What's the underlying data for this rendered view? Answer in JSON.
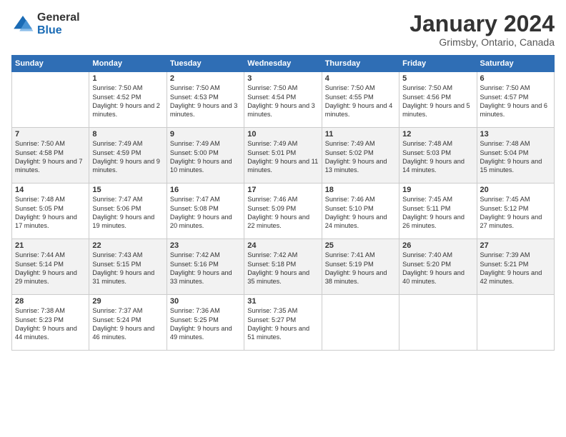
{
  "logo": {
    "general": "General",
    "blue": "Blue"
  },
  "title": "January 2024",
  "location": "Grimsby, Ontario, Canada",
  "weekdays": [
    "Sunday",
    "Monday",
    "Tuesday",
    "Wednesday",
    "Thursday",
    "Friday",
    "Saturday"
  ],
  "weeks": [
    [
      {
        "day": "",
        "sunrise": "",
        "sunset": "",
        "daylight": ""
      },
      {
        "day": "1",
        "sunrise": "Sunrise: 7:50 AM",
        "sunset": "Sunset: 4:52 PM",
        "daylight": "Daylight: 9 hours and 2 minutes."
      },
      {
        "day": "2",
        "sunrise": "Sunrise: 7:50 AM",
        "sunset": "Sunset: 4:53 PM",
        "daylight": "Daylight: 9 hours and 3 minutes."
      },
      {
        "day": "3",
        "sunrise": "Sunrise: 7:50 AM",
        "sunset": "Sunset: 4:54 PM",
        "daylight": "Daylight: 9 hours and 3 minutes."
      },
      {
        "day": "4",
        "sunrise": "Sunrise: 7:50 AM",
        "sunset": "Sunset: 4:55 PM",
        "daylight": "Daylight: 9 hours and 4 minutes."
      },
      {
        "day": "5",
        "sunrise": "Sunrise: 7:50 AM",
        "sunset": "Sunset: 4:56 PM",
        "daylight": "Daylight: 9 hours and 5 minutes."
      },
      {
        "day": "6",
        "sunrise": "Sunrise: 7:50 AM",
        "sunset": "Sunset: 4:57 PM",
        "daylight": "Daylight: 9 hours and 6 minutes."
      }
    ],
    [
      {
        "day": "7",
        "sunrise": "Sunrise: 7:50 AM",
        "sunset": "Sunset: 4:58 PM",
        "daylight": "Daylight: 9 hours and 7 minutes."
      },
      {
        "day": "8",
        "sunrise": "Sunrise: 7:49 AM",
        "sunset": "Sunset: 4:59 PM",
        "daylight": "Daylight: 9 hours and 9 minutes."
      },
      {
        "day": "9",
        "sunrise": "Sunrise: 7:49 AM",
        "sunset": "Sunset: 5:00 PM",
        "daylight": "Daylight: 9 hours and 10 minutes."
      },
      {
        "day": "10",
        "sunrise": "Sunrise: 7:49 AM",
        "sunset": "Sunset: 5:01 PM",
        "daylight": "Daylight: 9 hours and 11 minutes."
      },
      {
        "day": "11",
        "sunrise": "Sunrise: 7:49 AM",
        "sunset": "Sunset: 5:02 PM",
        "daylight": "Daylight: 9 hours and 13 minutes."
      },
      {
        "day": "12",
        "sunrise": "Sunrise: 7:48 AM",
        "sunset": "Sunset: 5:03 PM",
        "daylight": "Daylight: 9 hours and 14 minutes."
      },
      {
        "day": "13",
        "sunrise": "Sunrise: 7:48 AM",
        "sunset": "Sunset: 5:04 PM",
        "daylight": "Daylight: 9 hours and 15 minutes."
      }
    ],
    [
      {
        "day": "14",
        "sunrise": "Sunrise: 7:48 AM",
        "sunset": "Sunset: 5:05 PM",
        "daylight": "Daylight: 9 hours and 17 minutes."
      },
      {
        "day": "15",
        "sunrise": "Sunrise: 7:47 AM",
        "sunset": "Sunset: 5:06 PM",
        "daylight": "Daylight: 9 hours and 19 minutes."
      },
      {
        "day": "16",
        "sunrise": "Sunrise: 7:47 AM",
        "sunset": "Sunset: 5:08 PM",
        "daylight": "Daylight: 9 hours and 20 minutes."
      },
      {
        "day": "17",
        "sunrise": "Sunrise: 7:46 AM",
        "sunset": "Sunset: 5:09 PM",
        "daylight": "Daylight: 9 hours and 22 minutes."
      },
      {
        "day": "18",
        "sunrise": "Sunrise: 7:46 AM",
        "sunset": "Sunset: 5:10 PM",
        "daylight": "Daylight: 9 hours and 24 minutes."
      },
      {
        "day": "19",
        "sunrise": "Sunrise: 7:45 AM",
        "sunset": "Sunset: 5:11 PM",
        "daylight": "Daylight: 9 hours and 26 minutes."
      },
      {
        "day": "20",
        "sunrise": "Sunrise: 7:45 AM",
        "sunset": "Sunset: 5:12 PM",
        "daylight": "Daylight: 9 hours and 27 minutes."
      }
    ],
    [
      {
        "day": "21",
        "sunrise": "Sunrise: 7:44 AM",
        "sunset": "Sunset: 5:14 PM",
        "daylight": "Daylight: 9 hours and 29 minutes."
      },
      {
        "day": "22",
        "sunrise": "Sunrise: 7:43 AM",
        "sunset": "Sunset: 5:15 PM",
        "daylight": "Daylight: 9 hours and 31 minutes."
      },
      {
        "day": "23",
        "sunrise": "Sunrise: 7:42 AM",
        "sunset": "Sunset: 5:16 PM",
        "daylight": "Daylight: 9 hours and 33 minutes."
      },
      {
        "day": "24",
        "sunrise": "Sunrise: 7:42 AM",
        "sunset": "Sunset: 5:18 PM",
        "daylight": "Daylight: 9 hours and 35 minutes."
      },
      {
        "day": "25",
        "sunrise": "Sunrise: 7:41 AM",
        "sunset": "Sunset: 5:19 PM",
        "daylight": "Daylight: 9 hours and 38 minutes."
      },
      {
        "day": "26",
        "sunrise": "Sunrise: 7:40 AM",
        "sunset": "Sunset: 5:20 PM",
        "daylight": "Daylight: 9 hours and 40 minutes."
      },
      {
        "day": "27",
        "sunrise": "Sunrise: 7:39 AM",
        "sunset": "Sunset: 5:21 PM",
        "daylight": "Daylight: 9 hours and 42 minutes."
      }
    ],
    [
      {
        "day": "28",
        "sunrise": "Sunrise: 7:38 AM",
        "sunset": "Sunset: 5:23 PM",
        "daylight": "Daylight: 9 hours and 44 minutes."
      },
      {
        "day": "29",
        "sunrise": "Sunrise: 7:37 AM",
        "sunset": "Sunset: 5:24 PM",
        "daylight": "Daylight: 9 hours and 46 minutes."
      },
      {
        "day": "30",
        "sunrise": "Sunrise: 7:36 AM",
        "sunset": "Sunset: 5:25 PM",
        "daylight": "Daylight: 9 hours and 49 minutes."
      },
      {
        "day": "31",
        "sunrise": "Sunrise: 7:35 AM",
        "sunset": "Sunset: 5:27 PM",
        "daylight": "Daylight: 9 hours and 51 minutes."
      },
      {
        "day": "",
        "sunrise": "",
        "sunset": "",
        "daylight": ""
      },
      {
        "day": "",
        "sunrise": "",
        "sunset": "",
        "daylight": ""
      },
      {
        "day": "",
        "sunrise": "",
        "sunset": "",
        "daylight": ""
      }
    ]
  ]
}
